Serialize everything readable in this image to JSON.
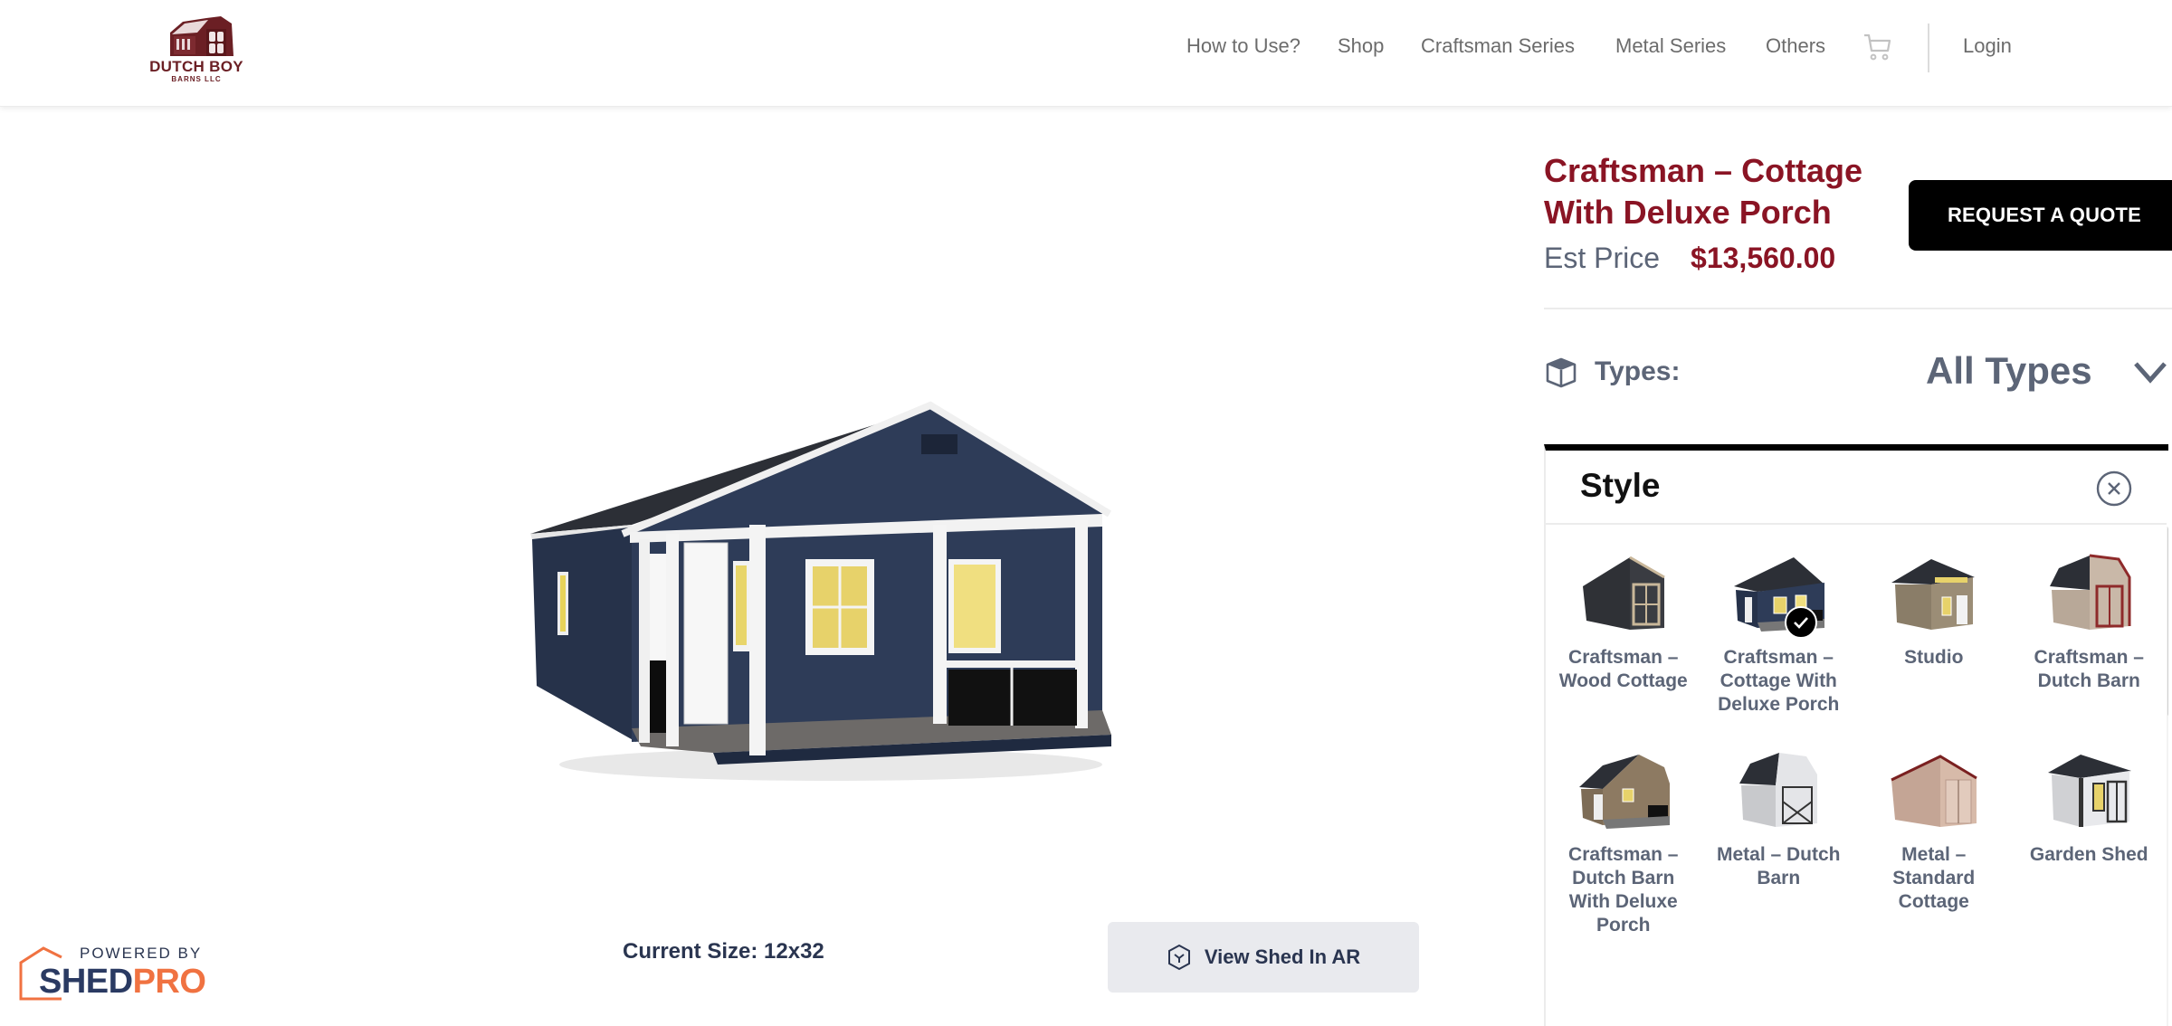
{
  "brand": {
    "name_line1": "DUTCH BOY",
    "name_line2": "BARNS LLC",
    "color": "#6b1f24"
  },
  "nav": {
    "links": [
      "How to Use?",
      "Shop",
      "Craftsman Series",
      "Metal Series",
      "Others"
    ],
    "cart_icon": "cart-icon",
    "login": "Login"
  },
  "product": {
    "title": "Craftsman – Cottage With Deluxe Porch",
    "price_label": "Est Price",
    "price_value": "$13,560.00",
    "quote_button": "REQUEST A QUOTE",
    "current_size": "Current Size: 12x32",
    "ar_button": "View Shed In AR",
    "accent_color": "#8a1424"
  },
  "types": {
    "label": "Types:",
    "value": "All Types",
    "icon": "box-icon"
  },
  "style_panel": {
    "title": "Style",
    "selected": "Craftsman – Cottage With Deluxe Porch",
    "items": [
      {
        "label": "Craftsman – Wood Cottage",
        "selected": false
      },
      {
        "label": "Craftsman – Cottage With Deluxe Porch",
        "selected": true
      },
      {
        "label": "Studio",
        "selected": false
      },
      {
        "label": "Craftsman – Dutch Barn",
        "selected": false
      },
      {
        "label": "Craftsman – Dutch Barn With Deluxe Porch",
        "selected": false
      },
      {
        "label": "Metal – Dutch Barn",
        "selected": false
      },
      {
        "label": "Metal – Standard Cottage",
        "selected": false
      },
      {
        "label": "Garden Shed",
        "selected": false
      }
    ]
  },
  "footer_badge": {
    "powered_by": "POWERED BY",
    "shed": "SHED",
    "pro": "PRO"
  }
}
